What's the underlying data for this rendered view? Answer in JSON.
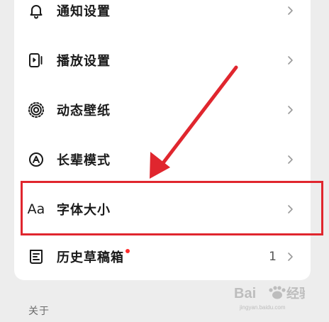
{
  "settings": {
    "items": [
      {
        "label": "通知设置",
        "icon": "bell-icon"
      },
      {
        "label": "播放设置",
        "icon": "play-settings-icon"
      },
      {
        "label": "动态壁纸",
        "icon": "wallpaper-icon"
      },
      {
        "label": "长辈模式",
        "icon": "elder-mode-icon"
      },
      {
        "label": "字体大小",
        "icon_text": "Aa",
        "icon": "font-size-icon"
      },
      {
        "label": "历史草稿箱",
        "icon": "drafts-icon",
        "count": "1",
        "has_dot": true
      }
    ]
  },
  "section": {
    "about_label": "关于"
  },
  "annotation": {
    "highlight_color": "#e0262e",
    "arrow_color": "#e0262e"
  },
  "watermark": {
    "text": "Baidu 经验",
    "icon": "baidu-paw-icon"
  }
}
